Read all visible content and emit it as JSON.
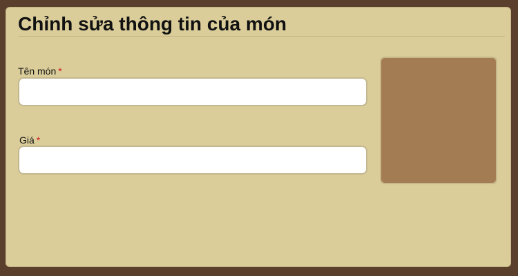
{
  "dialog": {
    "title": "Chỉnh sửa thông tin của món"
  },
  "form": {
    "required_marker": "*",
    "name_field": {
      "label": "Tên món",
      "value": "",
      "placeholder": ""
    },
    "price_field": {
      "label": "Giá",
      "value": "",
      "placeholder": ""
    }
  },
  "image_preview": {
    "color": "#a47c54"
  },
  "colors": {
    "background": "#5b3f2d",
    "panel": "#dacd9a",
    "required": "#d21a1a"
  }
}
